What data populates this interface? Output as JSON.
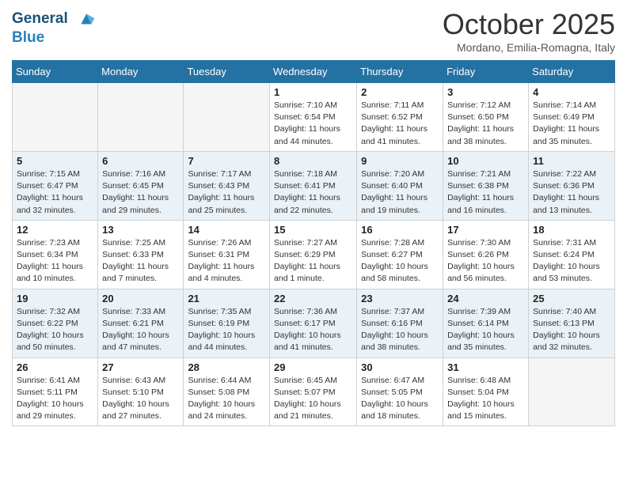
{
  "header": {
    "logo_line1": "General",
    "logo_line2": "Blue",
    "month_title": "October 2025",
    "location": "Mordano, Emilia-Romagna, Italy"
  },
  "days_of_week": [
    "Sunday",
    "Monday",
    "Tuesday",
    "Wednesday",
    "Thursday",
    "Friday",
    "Saturday"
  ],
  "weeks": [
    [
      {
        "day": "",
        "info": ""
      },
      {
        "day": "",
        "info": ""
      },
      {
        "day": "",
        "info": ""
      },
      {
        "day": "1",
        "info": "Sunrise: 7:10 AM\nSunset: 6:54 PM\nDaylight: 11 hours and 44 minutes."
      },
      {
        "day": "2",
        "info": "Sunrise: 7:11 AM\nSunset: 6:52 PM\nDaylight: 11 hours and 41 minutes."
      },
      {
        "day": "3",
        "info": "Sunrise: 7:12 AM\nSunset: 6:50 PM\nDaylight: 11 hours and 38 minutes."
      },
      {
        "day": "4",
        "info": "Sunrise: 7:14 AM\nSunset: 6:49 PM\nDaylight: 11 hours and 35 minutes."
      }
    ],
    [
      {
        "day": "5",
        "info": "Sunrise: 7:15 AM\nSunset: 6:47 PM\nDaylight: 11 hours and 32 minutes."
      },
      {
        "day": "6",
        "info": "Sunrise: 7:16 AM\nSunset: 6:45 PM\nDaylight: 11 hours and 29 minutes."
      },
      {
        "day": "7",
        "info": "Sunrise: 7:17 AM\nSunset: 6:43 PM\nDaylight: 11 hours and 25 minutes."
      },
      {
        "day": "8",
        "info": "Sunrise: 7:18 AM\nSunset: 6:41 PM\nDaylight: 11 hours and 22 minutes."
      },
      {
        "day": "9",
        "info": "Sunrise: 7:20 AM\nSunset: 6:40 PM\nDaylight: 11 hours and 19 minutes."
      },
      {
        "day": "10",
        "info": "Sunrise: 7:21 AM\nSunset: 6:38 PM\nDaylight: 11 hours and 16 minutes."
      },
      {
        "day": "11",
        "info": "Sunrise: 7:22 AM\nSunset: 6:36 PM\nDaylight: 11 hours and 13 minutes."
      }
    ],
    [
      {
        "day": "12",
        "info": "Sunrise: 7:23 AM\nSunset: 6:34 PM\nDaylight: 11 hours and 10 minutes."
      },
      {
        "day": "13",
        "info": "Sunrise: 7:25 AM\nSunset: 6:33 PM\nDaylight: 11 hours and 7 minutes."
      },
      {
        "day": "14",
        "info": "Sunrise: 7:26 AM\nSunset: 6:31 PM\nDaylight: 11 hours and 4 minutes."
      },
      {
        "day": "15",
        "info": "Sunrise: 7:27 AM\nSunset: 6:29 PM\nDaylight: 11 hours and 1 minute."
      },
      {
        "day": "16",
        "info": "Sunrise: 7:28 AM\nSunset: 6:27 PM\nDaylight: 10 hours and 58 minutes."
      },
      {
        "day": "17",
        "info": "Sunrise: 7:30 AM\nSunset: 6:26 PM\nDaylight: 10 hours and 56 minutes."
      },
      {
        "day": "18",
        "info": "Sunrise: 7:31 AM\nSunset: 6:24 PM\nDaylight: 10 hours and 53 minutes."
      }
    ],
    [
      {
        "day": "19",
        "info": "Sunrise: 7:32 AM\nSunset: 6:22 PM\nDaylight: 10 hours and 50 minutes."
      },
      {
        "day": "20",
        "info": "Sunrise: 7:33 AM\nSunset: 6:21 PM\nDaylight: 10 hours and 47 minutes."
      },
      {
        "day": "21",
        "info": "Sunrise: 7:35 AM\nSunset: 6:19 PM\nDaylight: 10 hours and 44 minutes."
      },
      {
        "day": "22",
        "info": "Sunrise: 7:36 AM\nSunset: 6:17 PM\nDaylight: 10 hours and 41 minutes."
      },
      {
        "day": "23",
        "info": "Sunrise: 7:37 AM\nSunset: 6:16 PM\nDaylight: 10 hours and 38 minutes."
      },
      {
        "day": "24",
        "info": "Sunrise: 7:39 AM\nSunset: 6:14 PM\nDaylight: 10 hours and 35 minutes."
      },
      {
        "day": "25",
        "info": "Sunrise: 7:40 AM\nSunset: 6:13 PM\nDaylight: 10 hours and 32 minutes."
      }
    ],
    [
      {
        "day": "26",
        "info": "Sunrise: 6:41 AM\nSunset: 5:11 PM\nDaylight: 10 hours and 29 minutes."
      },
      {
        "day": "27",
        "info": "Sunrise: 6:43 AM\nSunset: 5:10 PM\nDaylight: 10 hours and 27 minutes."
      },
      {
        "day": "28",
        "info": "Sunrise: 6:44 AM\nSunset: 5:08 PM\nDaylight: 10 hours and 24 minutes."
      },
      {
        "day": "29",
        "info": "Sunrise: 6:45 AM\nSunset: 5:07 PM\nDaylight: 10 hours and 21 minutes."
      },
      {
        "day": "30",
        "info": "Sunrise: 6:47 AM\nSunset: 5:05 PM\nDaylight: 10 hours and 18 minutes."
      },
      {
        "day": "31",
        "info": "Sunrise: 6:48 AM\nSunset: 5:04 PM\nDaylight: 10 hours and 15 minutes."
      },
      {
        "day": "",
        "info": ""
      }
    ]
  ]
}
